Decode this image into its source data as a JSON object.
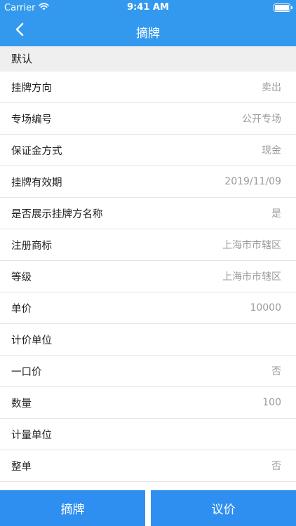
{
  "status_bar": {
    "carrier": "Carrier",
    "time": "9:41 AM"
  },
  "nav": {
    "title": "摘牌",
    "back_icon": "chevron-left-icon"
  },
  "section": {
    "title": "默认"
  },
  "rows": [
    {
      "label": "挂牌方向",
      "value": "卖出"
    },
    {
      "label": "专场编号",
      "value": "公开专场"
    },
    {
      "label": "保证金方式",
      "value": "现金"
    },
    {
      "label": "挂牌有效期",
      "value": "2019/11/09"
    },
    {
      "label": "是否展示挂牌方名称",
      "value": "是"
    },
    {
      "label": "注册商标",
      "value": "上海市市辖区"
    },
    {
      "label": "等级",
      "value": "上海市市辖区"
    },
    {
      "label": "单价",
      "value": "10000"
    },
    {
      "label": "计价单位",
      "value": ""
    },
    {
      "label": "一口价",
      "value": "否"
    },
    {
      "label": "数量",
      "value": "100"
    },
    {
      "label": "计量单位",
      "value": ""
    },
    {
      "label": "整单",
      "value": "否"
    }
  ],
  "footer": {
    "delist_label": "摘牌",
    "negotiate_label": "议价"
  },
  "colors": {
    "primary": "#3399ee",
    "button": "#2e8ff0",
    "section_bg": "#efefef",
    "value_text": "#9a9a9a"
  }
}
